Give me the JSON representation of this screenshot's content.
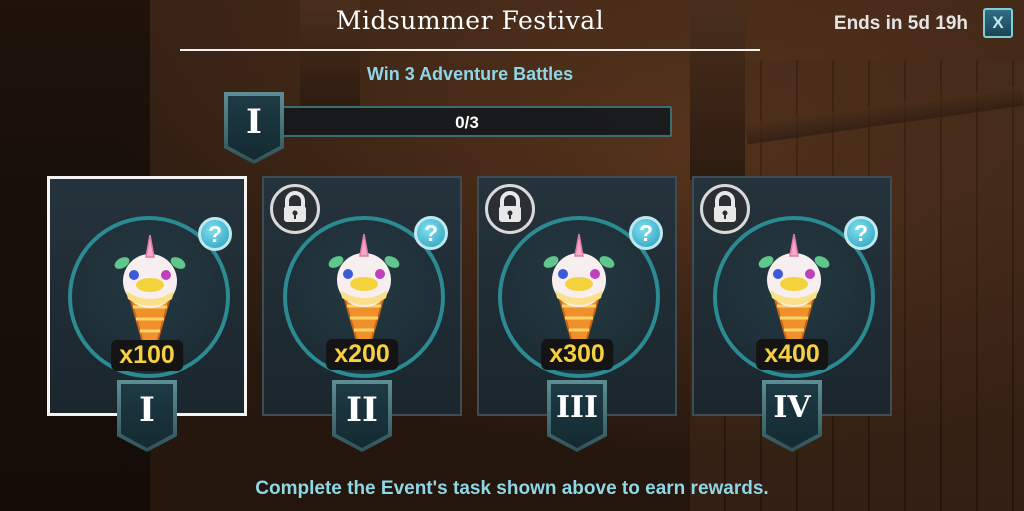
{
  "event": {
    "title": "Midsummer Festival",
    "timer": "Ends in 5d 19h",
    "close_label": "X",
    "task": "Win 3 Adventure Battles",
    "current_tier": "I",
    "progress": {
      "current": 0,
      "target": 3,
      "text": "0/3"
    }
  },
  "tiers": [
    {
      "numeral": "I",
      "quantity": "x100",
      "locked": false,
      "selected": true,
      "reward_icon": "unicorn-ice-cream-icon"
    },
    {
      "numeral": "II",
      "quantity": "x200",
      "locked": true,
      "selected": false,
      "reward_icon": "unicorn-ice-cream-icon"
    },
    {
      "numeral": "III",
      "quantity": "x300",
      "locked": true,
      "selected": false,
      "reward_icon": "unicorn-ice-cream-icon"
    },
    {
      "numeral": "IV",
      "quantity": "x400",
      "locked": true,
      "selected": false,
      "reward_icon": "unicorn-ice-cream-icon"
    }
  ],
  "help_glyph": "?",
  "footer_text": "Complete the Event's task shown above to earn rewards.",
  "colors": {
    "accent_teal": "#2c8a92",
    "text_cyan": "#8fd6e6",
    "quantity_gold": "#f6cf43"
  }
}
